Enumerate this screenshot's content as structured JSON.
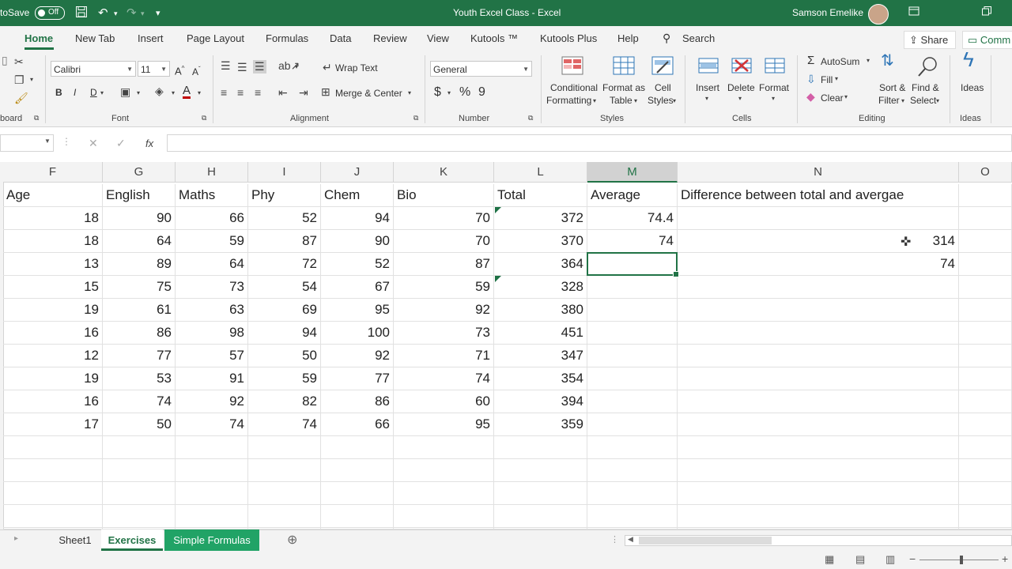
{
  "titlebar": {
    "autosave_label": "toSave",
    "autosave_state": "Off",
    "title": "Youth Excel Class  -  Excel",
    "user": "Samson Emelike"
  },
  "tabs": [
    "Home",
    "New Tab",
    "Insert",
    "Page Layout",
    "Formulas",
    "Data",
    "Review",
    "View",
    "Kutools ™",
    "Kutools Plus",
    "Help"
  ],
  "search_label": "Search",
  "share_label": "Share",
  "comments_label": "Comm",
  "ribbon": {
    "clipboard_label": "board",
    "font_name": "Calibri",
    "font_size": "11",
    "font_group": "Font",
    "wrap_text": "Wrap Text",
    "merge_center": "Merge & Center",
    "alignment_group": "Alignment",
    "number_format": "General",
    "number_group": "Number",
    "conditional_formatting": [
      "Conditional",
      "Formatting"
    ],
    "format_as_table": [
      "Format as",
      "Table"
    ],
    "cell_styles": [
      "Cell",
      "Styles"
    ],
    "styles_group": "Styles",
    "insert": "Insert",
    "delete": "Delete",
    "format": "Format",
    "cells_group": "Cells",
    "autosum": "AutoSum",
    "fill": "Fill",
    "clear": "Clear",
    "sort_filter": [
      "Sort &",
      "Filter"
    ],
    "find_select": [
      "Find &",
      "Select"
    ],
    "editing_group": "Editing",
    "ideas": "Ideas",
    "ideas_group": "Ideas"
  },
  "formula_bar": {
    "fx": "fx",
    "value": ""
  },
  "columns": [
    "F",
    "G",
    "H",
    "I",
    "J",
    "K",
    "L",
    "M",
    "N",
    "O"
  ],
  "headers": [
    "Age",
    "English",
    "Maths",
    "Phy",
    "Chem",
    "Bio",
    "Total",
    "Average",
    "Difference between total and avergae"
  ],
  "rows": [
    [
      "18",
      "90",
      "66",
      "52",
      "94",
      "70",
      "372",
      "74.4",
      ""
    ],
    [
      "18",
      "64",
      "59",
      "87",
      "90",
      "70",
      "370",
      "74",
      "314"
    ],
    [
      "13",
      "89",
      "64",
      "72",
      "52",
      "87",
      "364",
      "",
      "74"
    ],
    [
      "15",
      "75",
      "73",
      "54",
      "67",
      "59",
      "328",
      "",
      ""
    ],
    [
      "19",
      "61",
      "63",
      "69",
      "95",
      "92",
      "380",
      "",
      ""
    ],
    [
      "16",
      "86",
      "98",
      "94",
      "100",
      "73",
      "451",
      "",
      ""
    ],
    [
      "12",
      "77",
      "57",
      "50",
      "92",
      "71",
      "347",
      "",
      ""
    ],
    [
      "19",
      "53",
      "91",
      "59",
      "77",
      "74",
      "354",
      "",
      ""
    ],
    [
      "16",
      "74",
      "92",
      "82",
      "86",
      "60",
      "394",
      "",
      ""
    ],
    [
      "17",
      "50",
      "74",
      "74",
      "66",
      "95",
      "359",
      "",
      ""
    ]
  ],
  "sheets": [
    "Sheet1",
    "Exercises",
    "Simple Formulas"
  ],
  "colors": {
    "excel_green": "#217346",
    "sheet_green": "#21a366"
  }
}
